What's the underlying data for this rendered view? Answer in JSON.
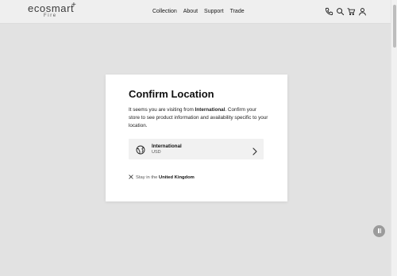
{
  "header": {
    "logo_main": "ecosmart",
    "logo_plus": "+",
    "logo_sub": "Fire",
    "nav": [
      "Collection",
      "About",
      "Support",
      "Trade"
    ],
    "icons": [
      "phone-icon",
      "search-icon",
      "cart-icon",
      "account-icon"
    ]
  },
  "modal": {
    "title": "Confirm Location",
    "body_prefix": "It seems you are visiting from ",
    "body_country": "International",
    "body_suffix": ". Confirm your store to see product information and availability specific to your location.",
    "option": {
      "name": "International",
      "currency": "USD",
      "icon": "globe-icon"
    },
    "stay_prefix": "Stay in the ",
    "stay_country": "United Kingdom"
  },
  "colors": {
    "overlay": "#e2e2e2",
    "header_bg": "#efefef",
    "option_bg": "#f1f1f1",
    "pause_button": "#9b9b9b"
  }
}
